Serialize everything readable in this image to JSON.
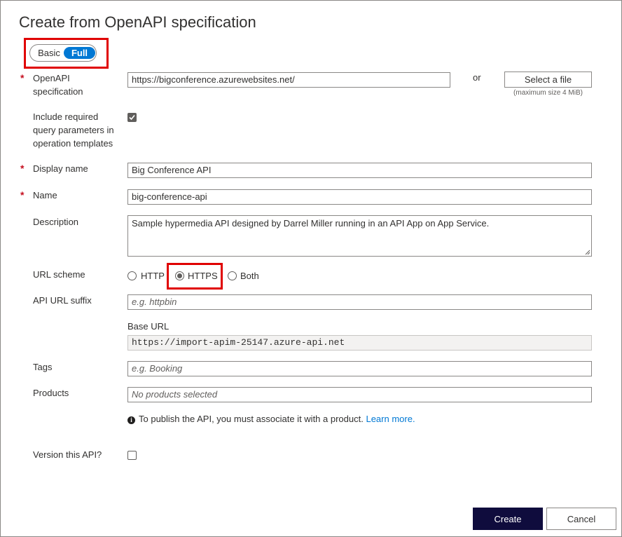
{
  "dialog": {
    "title": "Create from OpenAPI specification"
  },
  "mode_toggle": {
    "options": [
      "Basic",
      "Full"
    ],
    "selected": "Full"
  },
  "fields": {
    "openapi_spec": {
      "label": "OpenAPI specification",
      "required": true,
      "value": "https://bigconference.azurewebsites.net/",
      "or_text": "or",
      "file_button": "Select a file",
      "file_note": "(maximum size 4 MiB)"
    },
    "include_query": {
      "label": "Include required query parameters in operation templates",
      "checked": true
    },
    "display_name": {
      "label": "Display name",
      "required": true,
      "value": "Big Conference API"
    },
    "name": {
      "label": "Name",
      "required": true,
      "value": "big-conference-api"
    },
    "description": {
      "label": "Description",
      "value": "Sample hypermedia API designed by Darrel Miller running in an API App on App Service."
    },
    "url_scheme": {
      "label": "URL scheme",
      "options": [
        "HTTP",
        "HTTPS",
        "Both"
      ],
      "selected": "HTTPS"
    },
    "api_url_suffix": {
      "label": "API URL suffix",
      "placeholder": "e.g. httpbin"
    },
    "base_url": {
      "label": "Base URL",
      "value": "https://import-apim-25147.azure-api.net"
    },
    "tags": {
      "label": "Tags",
      "placeholder": "e.g. Booking"
    },
    "products": {
      "label": "Products",
      "placeholder": "No products selected",
      "info_text": "To publish the API, you must associate it with a product.",
      "info_link": "Learn more."
    },
    "version_api": {
      "label": "Version this API?",
      "checked": false
    }
  },
  "actions": {
    "create": "Create",
    "cancel": "Cancel"
  },
  "colors": {
    "accent": "#0078d4",
    "primary_button": "#0f0c3d",
    "required_star": "#c50f1f",
    "highlight_box": "#e00000"
  }
}
